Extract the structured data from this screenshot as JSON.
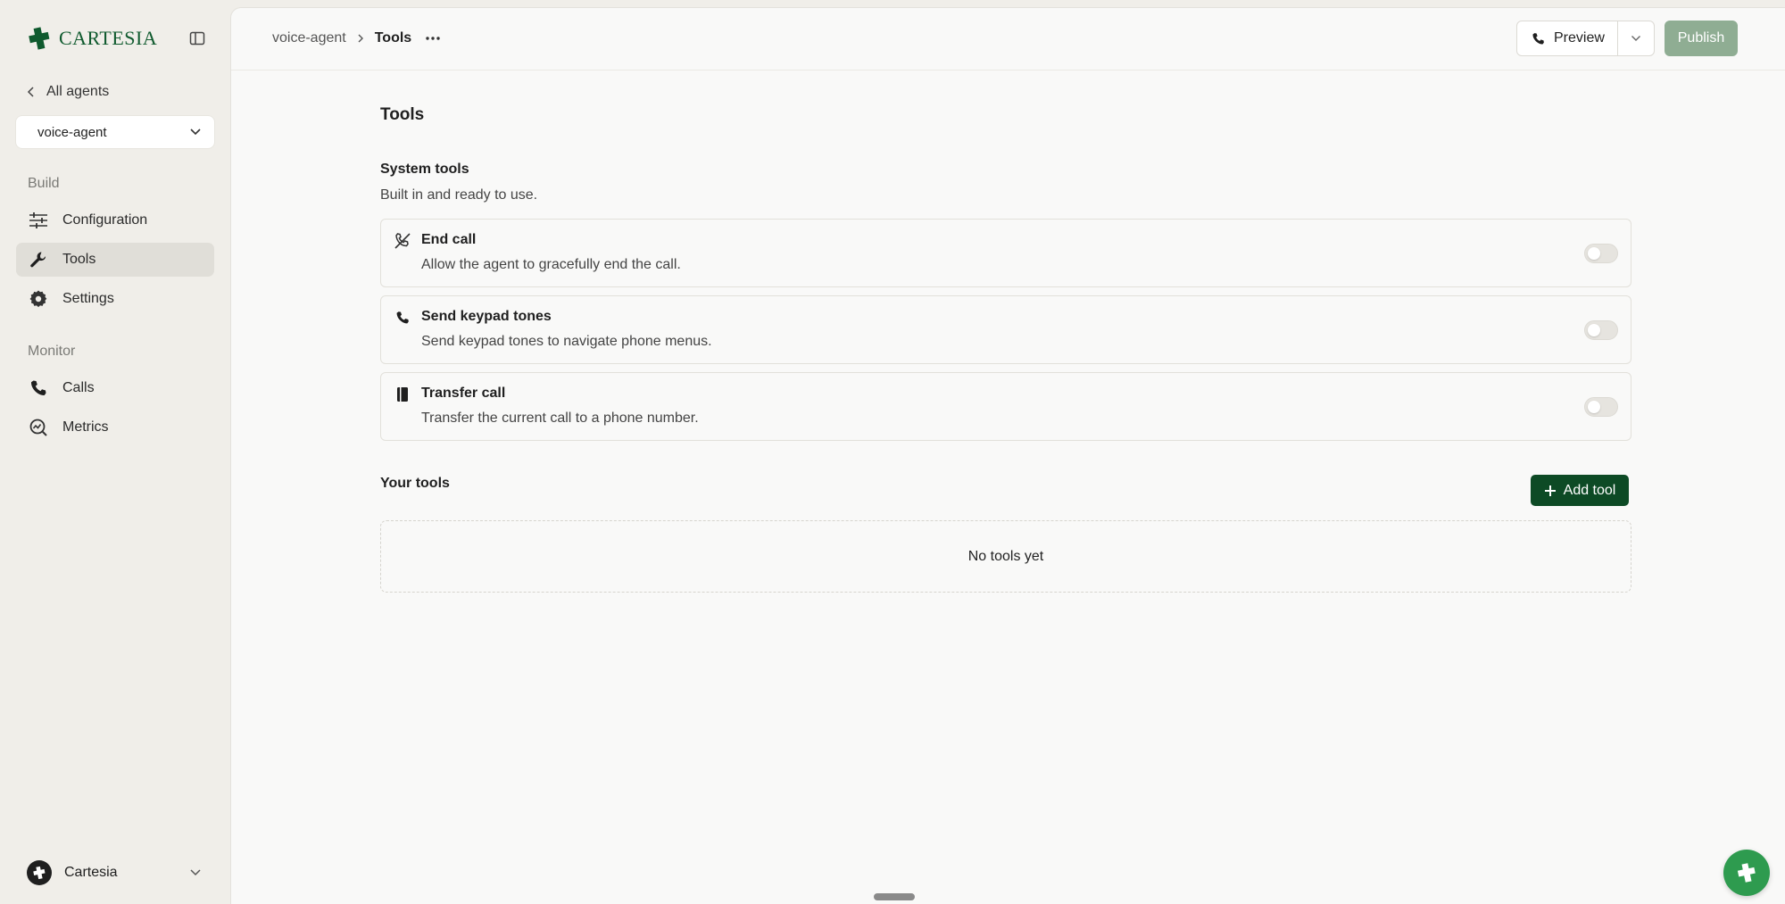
{
  "sidebar": {
    "brand": "CARTESIA",
    "back_label": "All agents",
    "agent_selector": "voice-agent",
    "build_label": "Build",
    "monitor_label": "Monitor",
    "items": [
      {
        "label": "Configuration",
        "icon": "sliders-icon"
      },
      {
        "label": "Tools",
        "icon": "wrench-icon",
        "active": true
      },
      {
        "label": "Settings",
        "icon": "gear-icon"
      },
      {
        "label": "Calls",
        "icon": "phone-icon"
      },
      {
        "label": "Metrics",
        "icon": "metrics-icon"
      }
    ],
    "account": "Cartesia"
  },
  "header": {
    "breadcrumb_parent": "voice-agent",
    "breadcrumb_current": "Tools",
    "preview_label": "Preview",
    "publish_label": "Publish"
  },
  "main": {
    "title": "Tools",
    "system_tools_title": "System tools",
    "system_tools_subtitle": "Built in and ready to use.",
    "system_tools": [
      {
        "name": "End call",
        "description": "Allow the agent to gracefully end the call.",
        "icon": "end-call-icon",
        "enabled": false
      },
      {
        "name": "Send keypad tones",
        "description": "Send keypad tones to navigate phone menus.",
        "icon": "phone-icon",
        "enabled": false
      },
      {
        "name": "Transfer call",
        "description": "Transfer the current call to a phone number.",
        "icon": "contact-book-icon",
        "enabled": false
      }
    ],
    "your_tools_title": "Your tools",
    "add_tool_label": "Add tool",
    "empty_label": "No tools yet"
  },
  "colors": {
    "brand": "#0f5a2e",
    "add_button": "#0d4a25",
    "publish_disabled": "#8fad93",
    "fab": "#2e9b4f"
  }
}
